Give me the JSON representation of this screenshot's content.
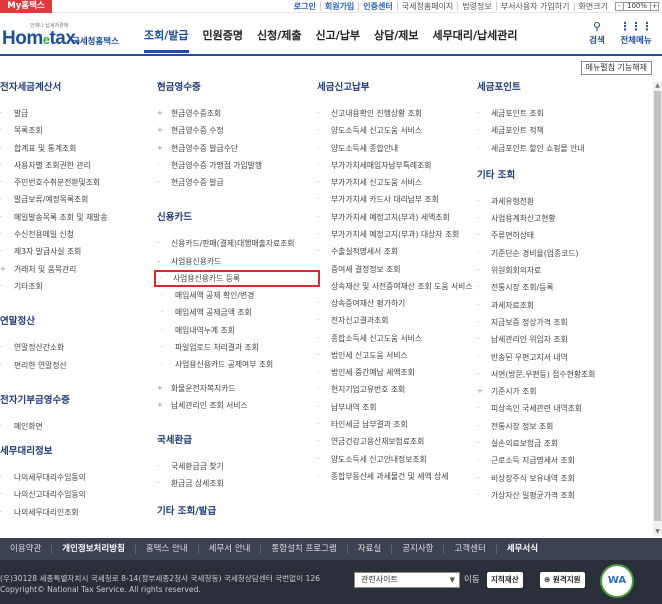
{
  "topbar": {
    "my_hometax": "My홈택스",
    "links": [
      "로그인",
      "회원가입",
      "인증센터",
      "국세청홈페이지",
      "법령정보",
      "부서사용자 가입하기",
      "화면크기"
    ],
    "zoom_minus": "-",
    "zoom_value": "100%",
    "zoom_plus": "+"
  },
  "header": {
    "logo_tag": "언제나 납세자곁에",
    "logo_main": "Hom",
    "logo_e": "e",
    "logo_main2": "tax.",
    "logo_sub": "국세청홈택스",
    "gnb": [
      "조회/발급",
      "민원증명",
      "신청/제출",
      "신고/납부",
      "상담/제보",
      "세무대리/납세관리"
    ],
    "search_label": "검색",
    "menu_label": "전체메뉴"
  },
  "sitemap": {
    "func_button": "메뉴펼침 기능해제",
    "col1": {
      "sections": [
        {
          "title": "전자세금계산서",
          "items": [
            "발급",
            "목록조회",
            "합계표 및 통계조회",
            "사용자별 조회권한 관리",
            "주민번호수취분전환및조회",
            "발급보류/예정목록조회",
            "메일발송목록 조회 및 재발송",
            "수신전용메일 신청",
            "제3자 발급사실 조회",
            "거래처 및 품목관리",
            "기타조회"
          ]
        },
        {
          "title": "연말정산",
          "items": [
            "연말정산간소화",
            "편리한 연말정산"
          ]
        },
        {
          "title": "전자기부금영수증",
          "items": [
            "메인화면"
          ]
        },
        {
          "title": "세무대리정보",
          "items": [
            "나의세무대리수임동의",
            "나의신고대리수임동의",
            "나의세무대리인조회"
          ]
        }
      ]
    },
    "col2": {
      "sections": [
        {
          "title": "현금영수증",
          "items": [
            "현금영수증조회",
            "현금영수증 수정",
            "현금영수증 발급수단",
            "현금영수증 가맹점 가입발행",
            "현금영수증 발급"
          ]
        },
        {
          "title": "신용카드",
          "items": [
            "신용카드/판매(결제)대행매출자료조회",
            "사업용신용카드"
          ],
          "subitems": [
            "사업용신용카드 등록",
            "매입세액 공제 확인/변경",
            "매입세액 공제금액 조회",
            "매입내역누계 조회",
            "파일업로드 처리결과 조회",
            "사업용신용카드 공제여부 조회"
          ],
          "after": [
            "화물운전자복지카드",
            "납세관리인 조회 서비스"
          ]
        },
        {
          "title": "국세환급",
          "items": [
            "국세환급금 찾기",
            "환급금 상세조회"
          ]
        },
        {
          "title": "기타 조회/발급",
          "items": []
        }
      ]
    },
    "col3": {
      "sections": [
        {
          "title": "세금신고납부",
          "items": [
            "신고내용확인 진행상황 조회",
            "양도소득세 신고도움 서비스",
            "양도소득세 종합안내",
            "부가가치세매입자납부특례조회",
            "부가가치세 신고도움 서비스",
            "부가가치세 카드사 대리납부 조회",
            "부가가치세 예정고지(부과) 세액조회",
            "부가가치세 예정고지(부과) 대상자 조회",
            "수출실적명세서 조회",
            "증여세 결정정보 조회",
            "상속재산 및 사전증여재산 조회 도움 서비스",
            "상속증여재산 평가하기",
            "전자신고결과조회",
            "종합소득세 신고도움 서비스",
            "법인세 신고도움 서비스",
            "법인세 중간예납 세액조회",
            "현지기업고유번호 조회",
            "납부내역 조회",
            "타인세금 납부결과 조회",
            "연금건강고용산재보험료조회",
            "양도소득세 신고안내정보조회",
            "종합부동산세 과세물건 및 세액 상세"
          ]
        }
      ]
    },
    "col4": {
      "sections": [
        {
          "title": "세금포인트",
          "items": [
            "세금포인트 조회",
            "세금포인트 적책",
            "세금포인트 할인 쇼핑몰 안내"
          ]
        },
        {
          "title": "기타 조회",
          "items": [
            "과세유형전환",
            "사업용계좌신고현황",
            "주류면허상태",
            "기준단순 경비율(업종코드)",
            "위원회회의자료",
            "전통시장 조회/등록",
            "과세자료조회",
            "지급보증 정상가격 조회",
            "납세관리인 위임자 조회",
            "반송된 우편고지서 내역",
            "서면(방문,우편등) 접수현황조회",
            "기준시가 조회",
            "피상속인 국세관련 내역조회",
            "전통시장 정보 조회",
            "실손의료보험금 조회",
            "근로소득 지급명세서 조회",
            "비상장주식 보유내역 조회",
            "가상자산 일평균가격 조회"
          ]
        }
      ]
    }
  },
  "footnav": [
    "이용약관",
    "개인정보처리방침",
    "홈택스 안내",
    "세무서 안내",
    "통합설치 프로그램",
    "자료실",
    "공지사항",
    "고객센터",
    "세무서식"
  ],
  "footer": {
    "addr1": "(우)30128 세종특별자치시 국세청로 8-14(정부세종2청사 국세청동) 국세청상담센터 국번없이 126",
    "addr2": "Copyright© National Tax Service. All rights reserved.",
    "select_value": "관련사이트",
    "go_label": "이동",
    "btn1": "지적재산",
    "btn2": "원격지원",
    "wa_mark": "WA"
  }
}
